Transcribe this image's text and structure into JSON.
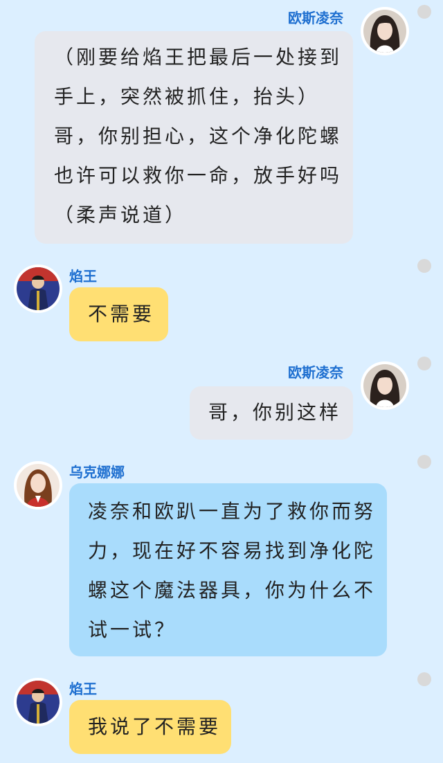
{
  "colors": {
    "background": "#dcefff",
    "name_text": "#1e6fd0",
    "bubble_gray": "#e6e8ee",
    "bubble_yellow": "#ffdf73",
    "bubble_blue": "#a9dcfc",
    "indicator_dot": "#d9d9d9"
  },
  "messages": [
    {
      "sender": "欧斯凌奈",
      "side": "right",
      "avatar_icon": "avatar-icon",
      "lines": [
        "（刚要给焰王把最后一处接到",
        "手上，突然被抓住，抬头）",
        "哥，你别担心，这个净化陀螺",
        "也许可以救你一命，放手好吗",
        "（柔声说道）"
      ]
    },
    {
      "sender": "焰王",
      "side": "left",
      "avatar_icon": "avatar-icon",
      "lines": [
        "不需要"
      ]
    },
    {
      "sender": "欧斯凌奈",
      "side": "right",
      "avatar_icon": "avatar-icon",
      "lines": [
        "哥，你别这样"
      ]
    },
    {
      "sender": "乌克娜娜",
      "side": "left",
      "avatar_icon": "avatar-icon",
      "lines": [
        "凌奈和欧趴一直为了救你而努",
        "力，现在好不容易找到净化陀",
        "螺这个魔法器具，你为什么不",
        "试一试？"
      ]
    },
    {
      "sender": "焰王",
      "side": "left",
      "avatar_icon": "avatar-icon",
      "lines": [
        "我说了不需要"
      ]
    }
  ]
}
